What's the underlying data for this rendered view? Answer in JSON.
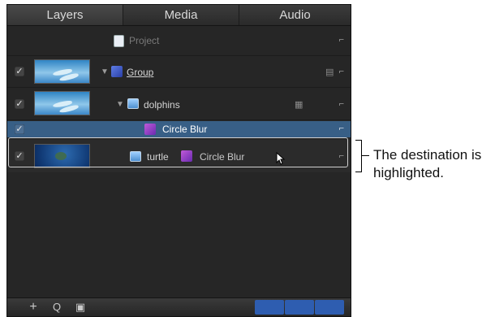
{
  "tabs": [
    "Layers",
    "Media",
    "Audio"
  ],
  "rows": {
    "project": {
      "label": "Project"
    },
    "group": {
      "label": "Group",
      "checked": "✓"
    },
    "dolphins": {
      "label": "dolphins",
      "checked": "✓"
    },
    "circle_blur": {
      "label": "Circle Blur",
      "checked": "✓"
    },
    "turtle": {
      "label": "turtle",
      "filter_label": "Circle Blur",
      "checked": "✓"
    }
  },
  "toolbar": {
    "add": "+",
    "search": "Q",
    "view": "▣"
  },
  "callout": "The destination is highlighted.",
  "colors": {
    "panel_bg": "#262626",
    "selected_row": "#385f86",
    "accent_blue": "#2e5db0"
  },
  "icons": [
    "project-doc-icon",
    "group-icon",
    "image-layer-icon",
    "filter-icon",
    "lock-icon",
    "expand-triangle-icon",
    "cursor-icon",
    "add-icon",
    "search-icon",
    "view-icon",
    "thumbnail-toggle-icon",
    "gear-icon",
    "layers-icon"
  ]
}
